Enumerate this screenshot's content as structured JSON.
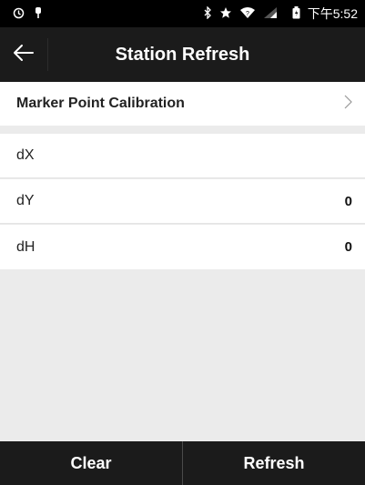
{
  "status_bar": {
    "time": "下午5:52",
    "left_icons": [
      "sync-icon",
      "usb-icon"
    ],
    "right_icons": [
      "bluetooth-icon",
      "star-icon",
      "signal-icon",
      "wifi-icon",
      "battery-icon"
    ]
  },
  "header": {
    "title": "Station Refresh",
    "back_icon": "arrow-left-icon"
  },
  "marker": {
    "label": "Marker Point Calibration",
    "chevron_icon": "chevron-right-icon"
  },
  "fields": [
    {
      "label": "dX",
      "value": ""
    },
    {
      "label": "dY",
      "value": "0"
    },
    {
      "label": "dH",
      "value": "0"
    }
  ],
  "footer": {
    "clear_label": "Clear",
    "refresh_label": "Refresh"
  },
  "colors": {
    "bar_background": "#1b1b1b",
    "page_background": "#ebebeb",
    "row_background": "#ffffff"
  }
}
